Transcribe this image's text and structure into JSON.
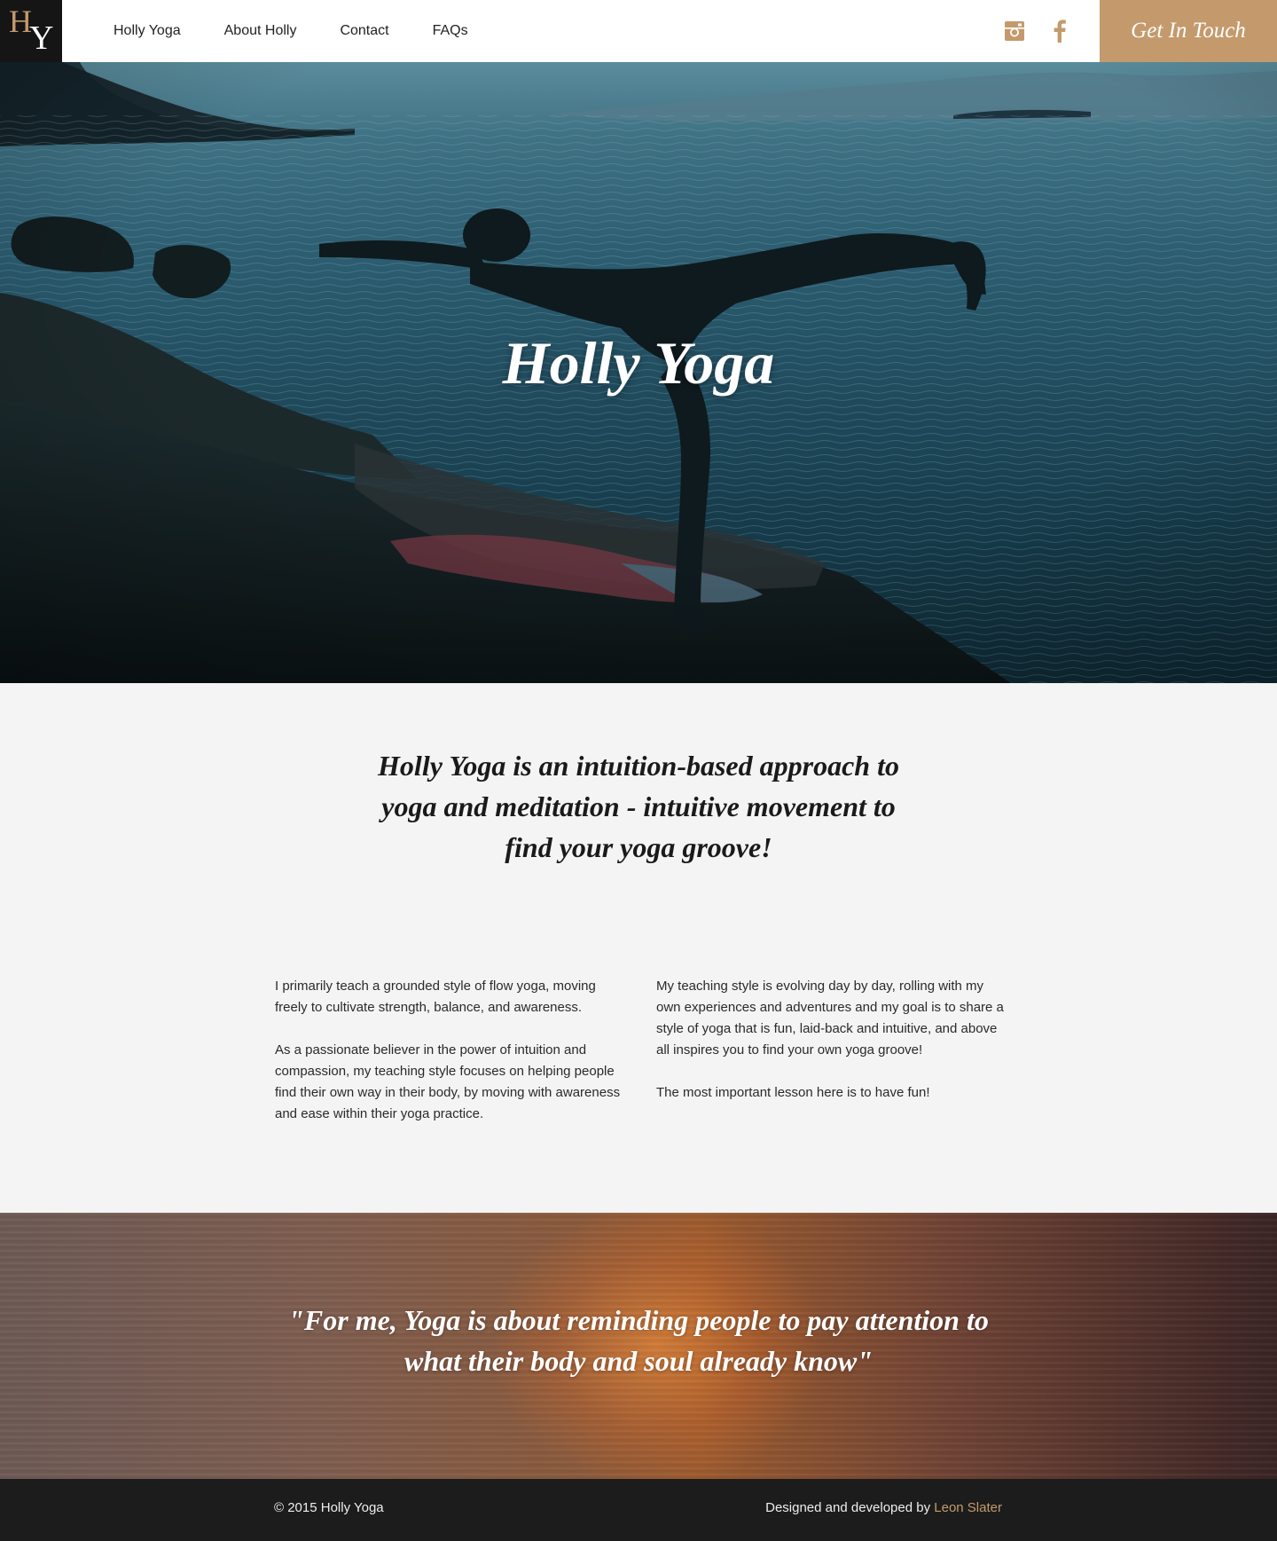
{
  "nav": {
    "logo": {
      "letter_h": "H",
      "letter_y": "Y"
    },
    "items": [
      {
        "label": "Holly Yoga"
      },
      {
        "label": "About Holly"
      },
      {
        "label": "Contact"
      },
      {
        "label": "FAQs"
      }
    ],
    "social": [
      "instagram-icon",
      "facebook-icon"
    ],
    "cta_label": "Get In Touch"
  },
  "hero": {
    "title": "Holly Yoga"
  },
  "intro": {
    "lead": "Holly Yoga is an intuition-based approach to yoga and meditation - intuitive movement to find your yoga groove!",
    "left": [
      "I primarily teach a grounded style of flow yoga, moving freely to cultivate strength, balance, and awareness.",
      "As a passionate believer in the power of intuition and compassion, my teaching style focuses on helping people find their own way in their body, by moving with awareness and ease within their yoga practice."
    ],
    "right": [
      "My teaching style is evolving day by day, rolling with my own experiences and adventures and my goal is to share a style of yoga that is fun, laid-back and intuitive, and above all inspires you to find your own yoga groove!",
      "The most important lesson here is to have fun!"
    ]
  },
  "quote": {
    "text": "\"For me, Yoga is about reminding people to pay attention to what their body and soul already know\""
  },
  "footer": {
    "copyright": "© 2015 Holly Yoga",
    "credit_prefix": "Designed and developed by ",
    "credit_name": "Leon Slater"
  },
  "colors": {
    "accent": "#c49a6c",
    "dark": "#1c1c1c",
    "light_bg": "#f4f4f4"
  }
}
